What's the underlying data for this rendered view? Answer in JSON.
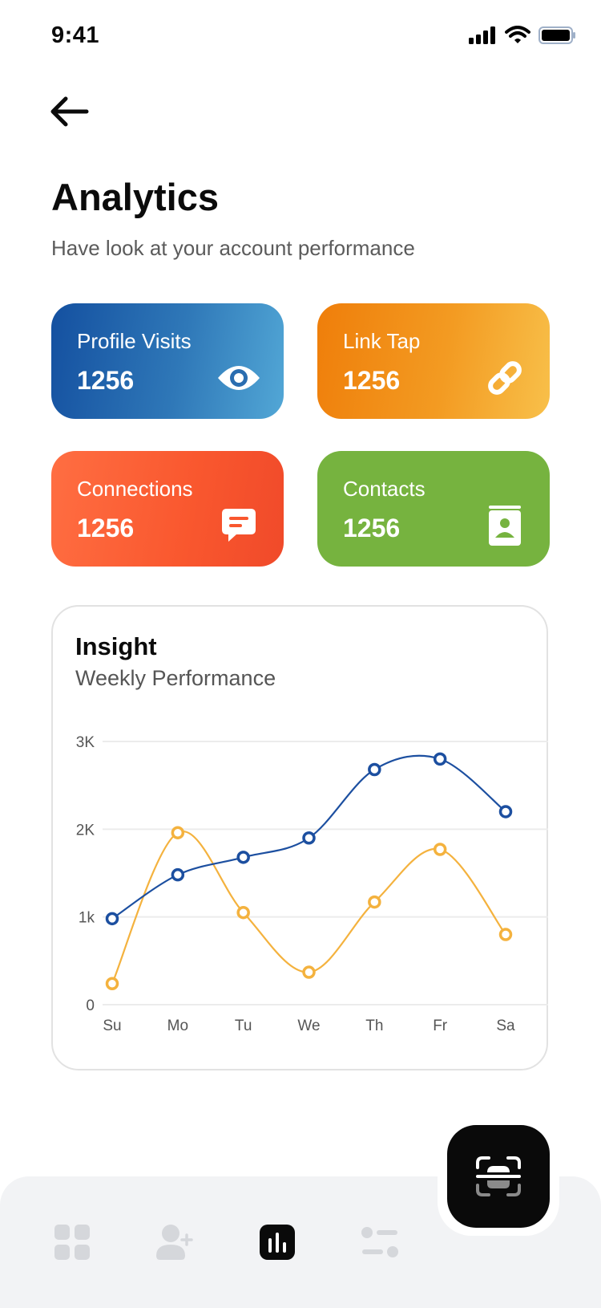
{
  "status_bar": {
    "time": "9:41"
  },
  "header": {
    "title": "Analytics",
    "subtitle": "Have look at your account performance"
  },
  "stats": [
    {
      "label": "Profile Visits",
      "value": "1256",
      "icon": "eye-icon"
    },
    {
      "label": "Link Tap",
      "value": "1256",
      "icon": "link-icon"
    },
    {
      "label": "Connections",
      "value": "1256",
      "icon": "chat-icon"
    },
    {
      "label": "Contacts",
      "value": "1256",
      "icon": "contact-book-icon"
    }
  ],
  "insight": {
    "title": "Insight",
    "subtitle": "Weekly Performance"
  },
  "chart_data": {
    "type": "line",
    "categories": [
      "Su",
      "Mo",
      "Tu",
      "We",
      "Th",
      "Fr",
      "Sa"
    ],
    "y_ticks": [
      {
        "value": 0,
        "label": "0"
      },
      {
        "value": 1000,
        "label": "1k"
      },
      {
        "value": 2000,
        "label": "2K"
      },
      {
        "value": 3000,
        "label": "3K"
      }
    ],
    "ylim": [
      0,
      3000
    ],
    "grid": true,
    "series": [
      {
        "color": "#1c4fa0",
        "values": [
          980,
          1480,
          1680,
          1900,
          2680,
          2800,
          2200
        ]
      },
      {
        "color": "#f4b23e",
        "values": [
          240,
          1960,
          1050,
          370,
          1170,
          1770,
          800
        ]
      }
    ]
  },
  "nav": {
    "items": [
      "dashboard-icon",
      "add-user-icon",
      "analytics-icon",
      "settings-sliders-icon"
    ],
    "active_index": 2,
    "fab_icon": "scan-icon"
  },
  "colors": {
    "nav_inactive": "#d5d7db",
    "nav_active": "#0a0a0a"
  }
}
